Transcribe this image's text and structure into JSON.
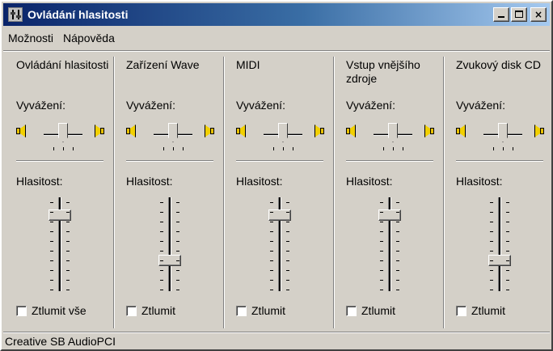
{
  "window": {
    "title": "Ovládání hlasitosti",
    "buttons": {
      "minimize": "minimize",
      "maximize": "maximize",
      "close": "×"
    }
  },
  "menu": {
    "items": [
      "Možnosti",
      "Nápověda"
    ]
  },
  "labels": {
    "balance": "Vyvážení:",
    "volume": "Hlasitost:"
  },
  "channels": [
    {
      "title": "Ovládání hlasitosti",
      "balance": 0.5,
      "volume": 0.85,
      "mute_label": "Ztlumit vše",
      "muted": false
    },
    {
      "title": "Zařízení Wave",
      "balance": 0.5,
      "volume": 0.3,
      "mute_label": "Ztlumit",
      "muted": false
    },
    {
      "title": "MIDI",
      "balance": 0.5,
      "volume": 0.85,
      "mute_label": "Ztlumit",
      "muted": false
    },
    {
      "title": "Vstup vnějšího zdroje",
      "balance": 0.5,
      "volume": 0.85,
      "mute_label": "Ztlumit",
      "muted": false
    },
    {
      "title": "Zvukový disk CD",
      "balance": 0.5,
      "volume": 0.3,
      "mute_label": "Ztlumit",
      "muted": false
    }
  ],
  "status": {
    "text": "Creative SB AudioPCI"
  },
  "colors": {
    "face": "#d4d0c8",
    "title_start": "#0a246a",
    "title_end": "#a6caf0",
    "speaker": "#f2d000"
  }
}
